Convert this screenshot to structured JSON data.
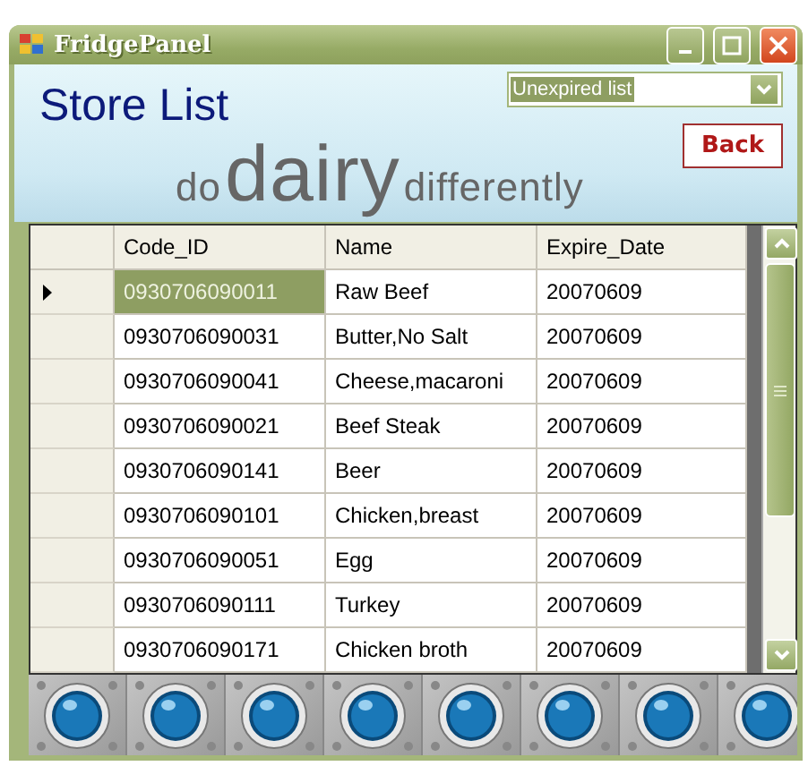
{
  "window": {
    "title": "FridgePanel"
  },
  "header": {
    "title": "Store List",
    "filter": {
      "value": "Unexpired list"
    },
    "back_button": "Back",
    "slogan": {
      "small_left": "do",
      "big": "dairy",
      "small_right": "differently"
    }
  },
  "table": {
    "columns": [
      "Code_ID",
      "Name",
      "Expire_Date"
    ],
    "rows": [
      {
        "cells": [
          "0930706090011",
          "Raw Beef",
          "20070609"
        ],
        "selected": true
      },
      {
        "cells": [
          "0930706090031",
          "Butter,No Salt",
          "20070609"
        ],
        "selected": false
      },
      {
        "cells": [
          "0930706090041",
          "Cheese,macaroni",
          "20070609"
        ],
        "selected": false
      },
      {
        "cells": [
          "0930706090021",
          "Beef Steak",
          "20070609"
        ],
        "selected": false
      },
      {
        "cells": [
          "0930706090141",
          "Beer",
          "20070609"
        ],
        "selected": false
      },
      {
        "cells": [
          "0930706090101",
          "Chicken,breast",
          "20070609"
        ],
        "selected": false
      },
      {
        "cells": [
          "0930706090051",
          "Egg",
          "20070609"
        ],
        "selected": false
      },
      {
        "cells": [
          "0930706090111",
          "Turkey",
          "20070609"
        ],
        "selected": false
      },
      {
        "cells": [
          "0930706090171",
          "Chicken broth",
          "20070609"
        ],
        "selected": false
      }
    ]
  },
  "round_buttons": [
    {
      "kind": "round"
    },
    {
      "kind": "round"
    },
    {
      "kind": "round"
    },
    {
      "kind": "round"
    },
    {
      "kind": "round"
    },
    {
      "kind": "round"
    },
    {
      "kind": "round"
    },
    {
      "kind": "round"
    }
  ]
}
